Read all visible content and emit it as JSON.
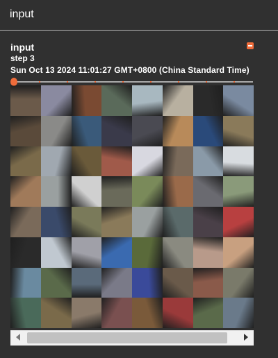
{
  "header": {
    "title": "input"
  },
  "card": {
    "title": "input",
    "step_label": "step",
    "step_value": "3",
    "timestamp": "Sun Oct 13 2024 11:01:27 GMT+0800 (China Standard Time)"
  },
  "slider": {
    "value": 0
  },
  "image_grid": {
    "rows": 8,
    "cols": 8,
    "tiles": [
      "#6b5a4a",
      "#8a8aa0",
      "#7a4a32",
      "#5a6a5a",
      "#a8b8c0",
      "#b8b0a0",
      "#2a2a2a",
      "#7a8aa0",
      "#5a4a3a",
      "#8a8a88",
      "#3a5a7a",
      "#3a3a4a",
      "#4a4a52",
      "#b88a5a",
      "#2a4a7a",
      "#8a7a5a",
      "#7a6a4a",
      "#a0a8b0",
      "#6a5a3a",
      "#a05a4a",
      "#d8d8e0",
      "#7a6a5a",
      "#8a9aa8",
      "#d8dce0",
      "#a07a5a",
      "#9aa0a0",
      "#d0d0d0",
      "#6a6a5a",
      "#7a8a5a",
      "#9a6a4a",
      "#6a6a70",
      "#8a9a7a",
      "#7a6a5a",
      "#3a4a6a",
      "#7a7a5a",
      "#8a7a5a",
      "#9aa0a0",
      "#5a6a6a",
      "#4a4048",
      "#b84040",
      "#2a2a2a",
      "#c0c8d0",
      "#a0a0a8",
      "#3a6ab0",
      "#5a6a3a",
      "#8a8a80",
      "#b89a8a",
      "#c8a080",
      "#6a8aa0",
      "#5a6a4a",
      "#5a6a7a",
      "#7a7a88",
      "#3a4a9a",
      "#6a5a4a",
      "#8a5a4a",
      "#7a7a6a",
      "#4a6a5a",
      "#7a6a4a",
      "#8a7a6a",
      "#7a5050",
      "#7a5a3a",
      "#9a3a3a",
      "#5a6a4a",
      "#6a7a8a"
    ]
  },
  "scrollbar": {
    "left_icon": "arrow-left-icon",
    "right_icon": "arrow-right-icon"
  },
  "colors": {
    "accent": "#ef6c3a",
    "background": "#303030",
    "text": "#ffffff"
  }
}
